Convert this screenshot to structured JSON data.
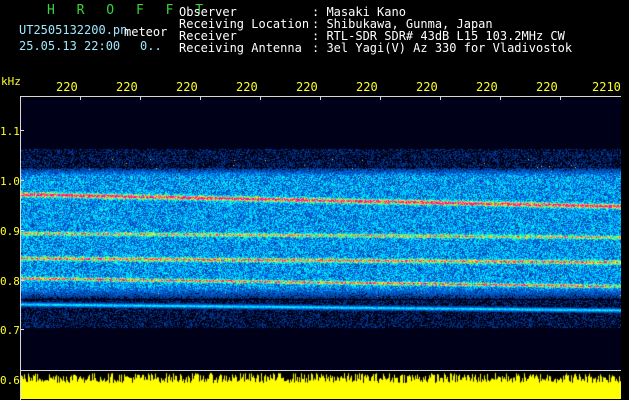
{
  "header": {
    "title": "H R O F F T",
    "filename": "UT2505132200.pn",
    "type_label": "meteor",
    "timestamp": "25.05.13 22:00",
    "count": "0..",
    "rows": [
      {
        "label": "Observer",
        "value": ": Masaki Kano"
      },
      {
        "label": "Receiving Location",
        "value": ": Shibukawa, Gunma, Japan"
      },
      {
        "label": "Receiver",
        "value": ": RTL-SDR SDR# 43dB L15 103.2MHz CW"
      },
      {
        "label": "Receiving Antenna",
        "value": ": 3el Yagi(V) Az 330 for Vladivostok"
      }
    ]
  },
  "y_axis": {
    "unit": "kHz",
    "ticks": [
      "1.1",
      "1.0",
      "0.9",
      "0.8",
      "0.7",
      "0.6"
    ]
  },
  "x_axis": {
    "ticks": [
      "220",
      "220",
      "220",
      "220",
      "220",
      "220",
      "220",
      "220",
      "220",
      "2210"
    ]
  },
  "colors": {
    "background": "#000000",
    "axis": "#d8d8d8",
    "tick_text": "#ffff2a",
    "header_title": "#3cd23c",
    "power_trace": "#ffff00"
  }
}
